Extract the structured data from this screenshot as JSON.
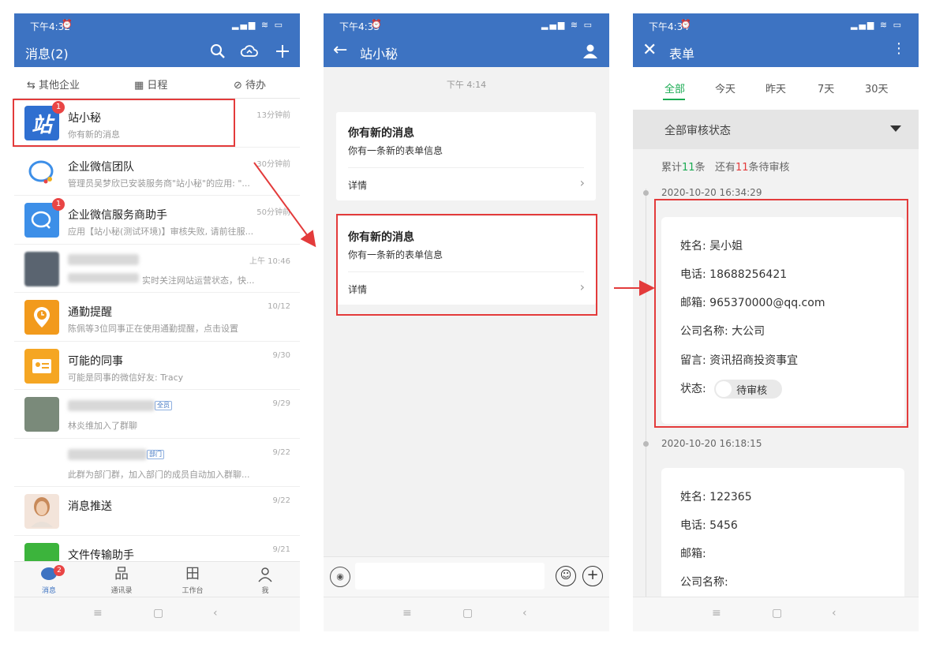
{
  "panel1": {
    "status_time": "下午4:32",
    "title": "消息(2)",
    "toolbar": [
      {
        "label": "其他企业",
        "icon": "swap-icon"
      },
      {
        "label": "日程",
        "icon": "calendar-icon"
      },
      {
        "label": "待办",
        "icon": "check-circle-icon"
      }
    ],
    "chats": [
      {
        "name": "站小秘",
        "preview": "你有新的消息",
        "time": "13分钟前",
        "badge": "1",
        "avatar_text": "站",
        "avatar_color": "#2f6fd0"
      },
      {
        "name": "企业微信团队",
        "preview": "管理员吴梦欣已安装服务商\"站小秘\"的应用: \"...",
        "time": "30分钟前",
        "badge": "",
        "avatar_text": "",
        "avatar_color": "#ffffff"
      },
      {
        "name": "企业微信服务商助手",
        "preview": "应用【站小秘(测试环境)】审核失败, 请前往服...",
        "time": "50分钟前",
        "badge": "1",
        "avatar_text": "",
        "avatar_color": "#3d8fe8"
      },
      {
        "name": "",
        "preview": "实时关注网站运营状态，快...",
        "time": "上午 10:46",
        "badge": "",
        "avatar_text": "",
        "avatar_color": "#5a6470"
      },
      {
        "name": "通勤提醒",
        "preview": "陈佩等3位同事正在使用通勤提醒，点击设置",
        "time": "10/12",
        "badge": "",
        "avatar_text": "",
        "avatar_color": "#f29a1c"
      },
      {
        "name": "可能的同事",
        "preview": "可能是同事的微信好友: Tracy",
        "time": "9/30",
        "badge": "",
        "avatar_text": "",
        "avatar_color": "#f5a623"
      },
      {
        "name": "",
        "preview": "林炎维加入了群聊",
        "time": "9/29",
        "badge": "",
        "avatar_text": "",
        "avatar_color": "#7a8a7a",
        "tag": "全员"
      },
      {
        "name": "",
        "preview": "此群为部门群，加入部门的成员自动加入群聊...",
        "time": "9/22",
        "badge": "",
        "avatar_text": "",
        "avatar_color": "#d8b040",
        "tag": "部门"
      },
      {
        "name": "消息推送",
        "preview": "",
        "time": "9/22",
        "badge": "",
        "avatar_text": "",
        "avatar_color": "#c88a6a"
      },
      {
        "name": "文件传输助手",
        "preview": "",
        "time": "9/21",
        "badge": "",
        "avatar_text": "",
        "avatar_color": "#3cb43c"
      }
    ],
    "tabs": [
      {
        "label": "消息",
        "badge": "2"
      },
      {
        "label": "通讯录",
        "badge": ""
      },
      {
        "label": "工作台",
        "badge": ""
      },
      {
        "label": "我",
        "badge": ""
      }
    ]
  },
  "panel2": {
    "status_time": "下午4:33",
    "title": "站小秘",
    "sys_time": "下午 4:14",
    "messages": [
      {
        "title": "你有新的消息",
        "subtitle": "你有一条新的表单信息",
        "detail": "详情"
      },
      {
        "title": "你有新的消息",
        "subtitle": "你有一条新的表单信息",
        "detail": "详情"
      }
    ]
  },
  "panel3": {
    "status_time": "下午4:34",
    "title": "表单",
    "filters": [
      "全部",
      "今天",
      "昨天",
      "7天",
      "30天"
    ],
    "dropdown": "全部审核状态",
    "summary": {
      "prefix": "累计",
      "total": "11",
      "mid": "条",
      "prefix2": "还有",
      "pending": "11",
      "suffix": "条待审核"
    },
    "entries": [
      {
        "time": "2020-10-20 16:34:29",
        "name": "姓名: 吴小姐",
        "phone": "电话: 18688256421",
        "email": "邮箱: 965370000@qq.com",
        "company": "公司名称: 大公司",
        "message": "留言: 资讯招商投资事宜",
        "status_label": "状态:",
        "status_value": "待审核"
      },
      {
        "time": "2020-10-20 16:18:15",
        "name": "姓名: 122365",
        "phone": "电话: 5456",
        "email": "邮箱:",
        "company": "公司名称:"
      }
    ]
  },
  "colors": {
    "header_blue": "#3d73c2",
    "highlight_red": "#e33b3b",
    "accent_green": "#1aab52"
  }
}
